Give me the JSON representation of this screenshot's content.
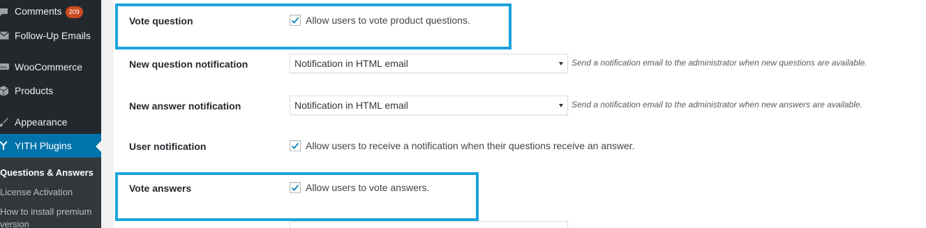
{
  "sidebar": {
    "items": [
      {
        "label": "Comments",
        "icon": "comments-icon",
        "badge": "209"
      },
      {
        "label": "Follow-Up Emails",
        "icon": "envelope-icon"
      },
      {
        "label": "WooCommerce",
        "icon": "woo-icon"
      },
      {
        "label": "Products",
        "icon": "products-icon"
      },
      {
        "label": "Appearance",
        "icon": "brush-icon"
      },
      {
        "label": "YITH Plugins",
        "icon": "yith-icon"
      }
    ],
    "submenu": [
      {
        "label": "Questions & Answers"
      },
      {
        "label": "License Activation"
      },
      {
        "label": "How to install premium"
      },
      {
        "label": "version"
      }
    ]
  },
  "settings": {
    "vote_question": {
      "label": "Vote question",
      "checkbox_label": "Allow users to vote product questions.",
      "checked": true
    },
    "new_question_notification": {
      "label": "New question notification",
      "value": "Notification in HTML email",
      "description": "Send a notification email to the administrator when new questions are available."
    },
    "new_answer_notification": {
      "label": "New answer notification",
      "value": "Notification in HTML email",
      "description": "Send a notification email to the administrator when new answers are available."
    },
    "user_notification": {
      "label": "User notification",
      "checkbox_label": "Allow users to receive a notification when their questions receive an answer.",
      "checked": true
    },
    "vote_answers": {
      "label": "Vote answers",
      "checkbox_label": "Allow users to vote answers.",
      "checked": true
    }
  },
  "colors": {
    "highlight": "#1aa3dc",
    "active_menu": "#0073aa",
    "sidebar_bg": "#23282d",
    "badge": "#ca4a1f"
  }
}
